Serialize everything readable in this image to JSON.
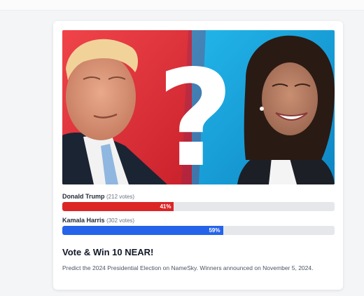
{
  "poll": {
    "options": [
      {
        "name": "Donald Trump",
        "votes": "(212 votes)",
        "percent_label": "41%",
        "percent": 0.41,
        "color": "#dc2626"
      },
      {
        "name": "Kamala Harris",
        "votes": "(302 votes)",
        "percent_label": "59%",
        "percent": 0.59,
        "color": "#2563eb"
      }
    ]
  },
  "card": {
    "title": "Vote & Win 10 NEAR!",
    "description": "Predict the 2024 Presidential Election on NameSky. Winners announced on November 5, 2024."
  },
  "hero": {
    "glyph": "?",
    "left_color": "#e8343a",
    "right_color": "#1aa6df"
  }
}
